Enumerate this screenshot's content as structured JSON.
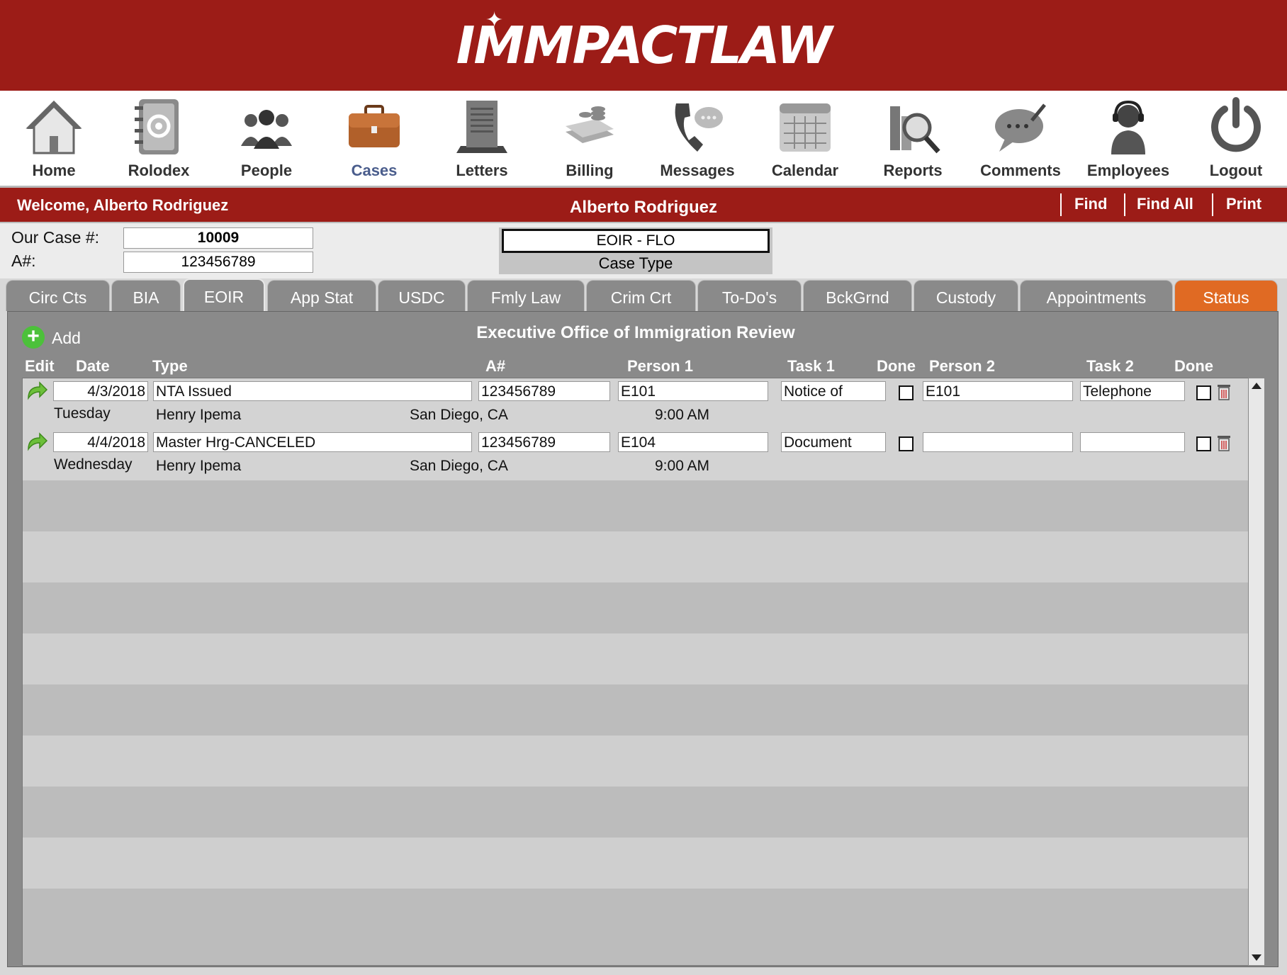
{
  "app": {
    "logo": "IMMPACTLAW"
  },
  "nav": [
    {
      "label": "Home",
      "icon": "home-icon"
    },
    {
      "label": "Rolodex",
      "icon": "rolodex-icon"
    },
    {
      "label": "People",
      "icon": "people-icon"
    },
    {
      "label": "Cases",
      "icon": "briefcase-icon"
    },
    {
      "label": "Letters",
      "icon": "letters-icon"
    },
    {
      "label": "Billing",
      "icon": "billing-icon"
    },
    {
      "label": "Messages",
      "icon": "phone-message-icon"
    },
    {
      "label": "Calendar",
      "icon": "calendar-icon"
    },
    {
      "label": "Reports",
      "icon": "reports-magnifier-icon"
    },
    {
      "label": "Comments",
      "icon": "comment-bubble-icon"
    },
    {
      "label": "Employees",
      "icon": "headset-employee-icon"
    },
    {
      "label": "Logout",
      "icon": "power-icon"
    }
  ],
  "welcome": {
    "greeting": "Welcome, Alberto Rodriguez",
    "client_name": "Alberto Rodriguez",
    "find": "Find",
    "find_all": "Find All",
    "print": "Print"
  },
  "case": {
    "our_case_label": "Our Case #:",
    "our_case_value": "10009",
    "a_label": "A#:",
    "a_value": "123456789",
    "case_type_value": "EOIR - FLO",
    "case_type_label": "Case Type"
  },
  "tabs": [
    "Circ Cts",
    "BIA",
    "EOIR",
    "App Stat",
    "USDC",
    "Fmly Law",
    "Crim Crt",
    "To-Do's",
    "BckGrnd",
    "Custody",
    "Appointments",
    "Status"
  ],
  "panel": {
    "add_label": "Add",
    "title": "Executive Office of Immigration Review",
    "columns": [
      "Edit",
      "Date",
      "Type",
      "A#",
      "Person 1",
      "Task 1",
      "Done",
      "Person 2",
      "Task 2",
      "Done"
    ]
  },
  "records": [
    {
      "date": "4/3/2018",
      "day": "Tuesday",
      "type": "NTA Issued",
      "anum": "123456789",
      "person1": "E101",
      "task1": "Notice of",
      "person2": "E101",
      "task2": "Telephone",
      "judge": "Henry Ipema",
      "location": "San Diego, CA",
      "time": "9:00 AM"
    },
    {
      "date": "4/4/2018",
      "day": "Wednesday",
      "type": "Master Hrg-CANCELED",
      "anum": "123456789",
      "person1": "E104",
      "task1": "Document",
      "person2": "",
      "task2": "",
      "judge": "Henry Ipema",
      "location": "San Diego, CA",
      "time": "9:00 AM"
    }
  ],
  "colors": {
    "brand": "#9c1c17",
    "active_tab": "#e06a23",
    "panel": "#8a8a8a",
    "add": "#4cc13a"
  }
}
